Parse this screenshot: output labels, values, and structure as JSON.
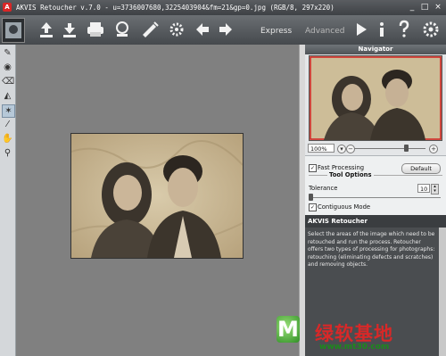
{
  "window": {
    "app_logo": "A",
    "title": "AKVIS Retoucher v.7.0 - u=3736007680,3225403904&fm=21&gp=0.jpg (RGB/8, 297x220)",
    "minimize": "_",
    "maximize": "□",
    "close": "×"
  },
  "toolbar": {
    "modes": [
      "Express",
      "Advanced"
    ],
    "active_mode": "Express"
  },
  "navigator": {
    "title": "Navigator",
    "zoom": "100%",
    "zoom_level": 0.72
  },
  "options": {
    "fast_processing_label": "Fast Processing",
    "fast_processing_checked": true,
    "default_button": "Default",
    "tool_options_title": "Tool Options",
    "tolerance_label": "Tolerance",
    "tolerance_value": "10",
    "contiguous_mode_label": "Contiguous Mode",
    "contiguous_mode_checked": true,
    "check_mark": "✓"
  },
  "help": {
    "title": "AKVIS Retoucher",
    "text": "Select the areas of the image which need to be retouched and run the process. Retoucher offers two types of processing for photographs: retouching (eliminating defects and scratches) and removing objects."
  },
  "watermark": {
    "logo_letter": "M",
    "chinese_text": "绿软基地",
    "url": "www.mt30.com"
  },
  "colors": {
    "canvas_bg": "#808080",
    "toolbar": "#45494d",
    "help_bg": "#4a4d50",
    "watermark_red": "#d82828",
    "watermark_green": "#1c8a1c"
  }
}
